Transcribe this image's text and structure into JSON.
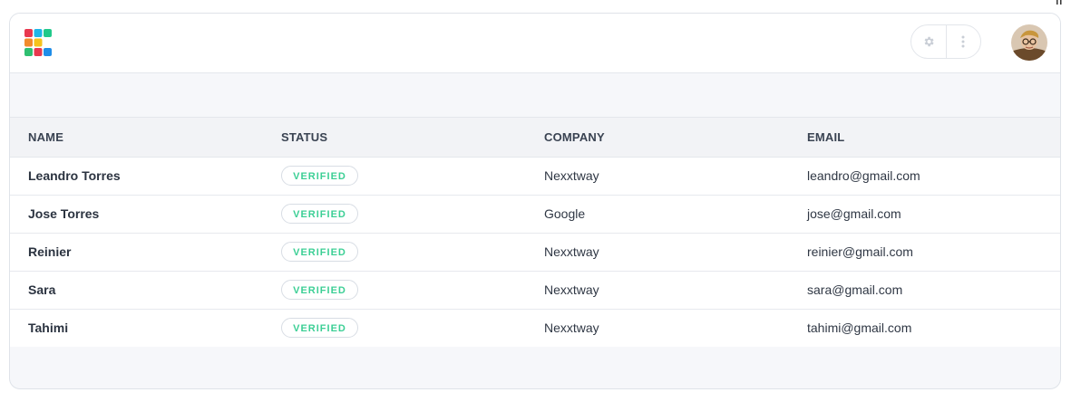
{
  "header": {
    "logo": "grid-logo",
    "settings_icon": "gear-icon",
    "more_icon": "vertical-dots-icon",
    "avatar": "user-avatar"
  },
  "table": {
    "columns": [
      "NAME",
      "STATUS",
      "COMPANY",
      "EMAIL"
    ],
    "rows": [
      {
        "name": "Leandro Torres",
        "status": "VERIFIED",
        "company": "Nexxtway",
        "email": "leandro@gmail.com"
      },
      {
        "name": "Jose Torres",
        "status": "VERIFIED",
        "company": "Google",
        "email": "jose@gmail.com"
      },
      {
        "name": "Reinier",
        "status": "VERIFIED",
        "company": "Nexxtway",
        "email": "reinier@gmail.com"
      },
      {
        "name": "Sara",
        "status": "VERIFIED",
        "company": "Nexxtway",
        "email": "sara@gmail.com"
      },
      {
        "name": "Tahimi",
        "status": "VERIFIED",
        "company": "Nexxtway",
        "email": "tahimi@gmail.com"
      }
    ]
  },
  "colors": {
    "verified": "#3ccf95",
    "border": "#dfe3e9",
    "band": "#f6f7fa"
  }
}
